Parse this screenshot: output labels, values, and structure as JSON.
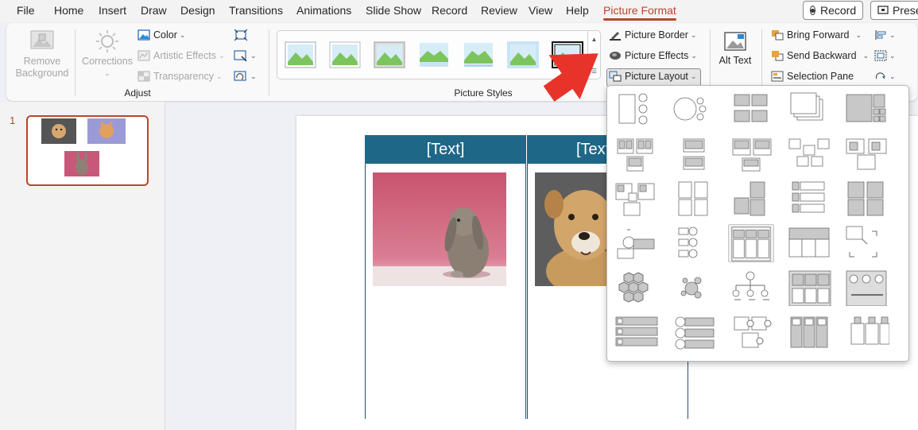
{
  "tabs": [
    "File",
    "Home",
    "Insert",
    "Draw",
    "Design",
    "Transitions",
    "Animations",
    "Slide Show",
    "Record",
    "Review",
    "View",
    "Help",
    "Picture Format"
  ],
  "active_tab": "Picture Format",
  "top_buttons": {
    "record": "Record",
    "present": "Present"
  },
  "adjust": {
    "remove_background": "Remove Background",
    "corrections": "Corrections",
    "color": "Color",
    "artistic_effects": "Artistic Effects",
    "transparency": "Transparency",
    "group_label": "Adjust"
  },
  "picture_styles": {
    "group_label": "Picture Styles",
    "picture_border": "Picture Border",
    "picture_effects": "Picture Effects",
    "picture_layout": "Picture Layout"
  },
  "accessibility": {
    "alt_text": "Alt Text"
  },
  "arrange": {
    "bring_forward": "Bring Forward",
    "send_backward": "Send Backward",
    "selection_pane": "Selection Pane"
  },
  "slides": [
    {
      "number": "1"
    }
  ],
  "slide": {
    "columns": [
      {
        "header": "[Text]",
        "picture": "rabbit"
      },
      {
        "header": "[Text]",
        "picture": "dog"
      }
    ]
  },
  "picture_layout_menu": {
    "rows": 6,
    "columns": 5,
    "selected_index": 17
  },
  "colors": {
    "accent": "#b7472a",
    "header_fill": "#1e6787",
    "arrow": "#e8332a"
  }
}
